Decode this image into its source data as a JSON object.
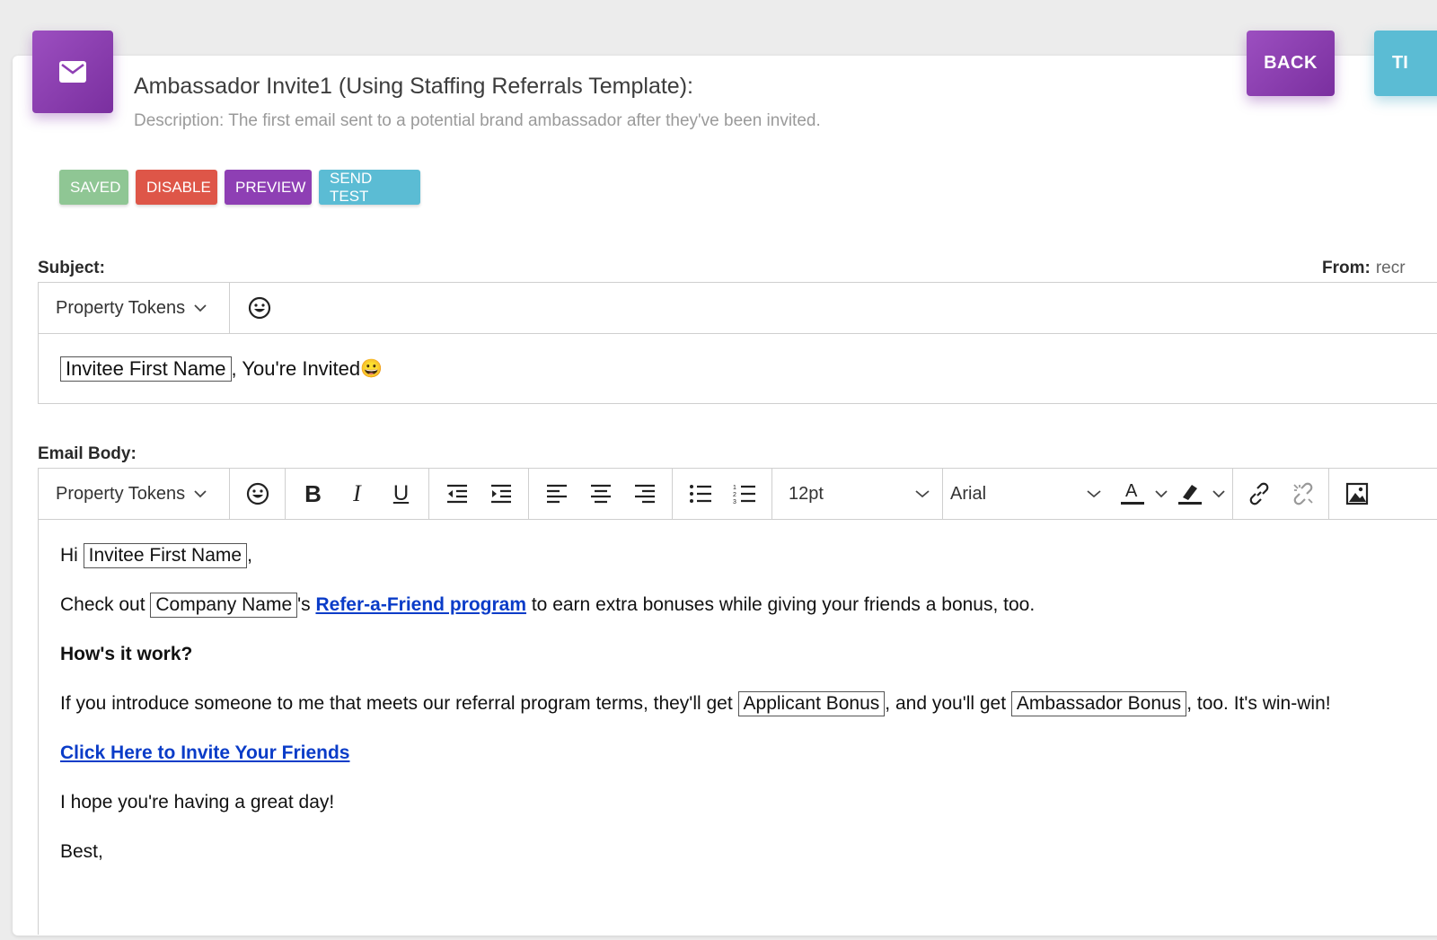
{
  "header": {
    "title": "Ambassador Invite1 (Using Staffing Referrals Template):",
    "description": "Description: The first email sent to a potential brand ambassador after they've been invited.",
    "back_label": "BACK",
    "cut_label": "TI"
  },
  "actions": {
    "saved": "SAVED",
    "disable": "DISABLE",
    "preview": "PREVIEW",
    "send_test": "SEND TEST"
  },
  "subject": {
    "label": "Subject:",
    "from_label": "From:",
    "from_value": "recr",
    "tokens_label": "Property Tokens",
    "token": "Invitee First Name",
    "text": ", You're Invited ",
    "emoji": "😀"
  },
  "body": {
    "label": "Email Body:",
    "tokens_label": "Property Tokens",
    "font_size": "12pt",
    "font_family": "Arial",
    "greeting_pre": "Hi ",
    "greeting_token": "Invitee First Name",
    "greeting_post": ",",
    "p1_pre": "Check out ",
    "p1_token": "Company Name",
    "p1_mid": "'s ",
    "p1_link": "Refer-a-Friend program",
    "p1_post": " to earn extra bonuses while giving your friends a bonus, too.",
    "heading": "How's it work?",
    "p2_pre": "If you introduce someone to me that meets our referral program terms, they'll get ",
    "p2_token1": "Applicant Bonus",
    "p2_mid": ", and you'll get ",
    "p2_token2": "Ambassador Bonus",
    "p2_post": ", too. It's win-win!",
    "cta": "Click Here to Invite Your Friends",
    "closing": "I hope you're having a great day!",
    "signoff": "Best,"
  },
  "colors": {
    "purple": "#8e3fb4",
    "teal": "#5bbcd4",
    "green": "#8fc694",
    "red": "#de5648",
    "link": "#0a3cc8"
  }
}
